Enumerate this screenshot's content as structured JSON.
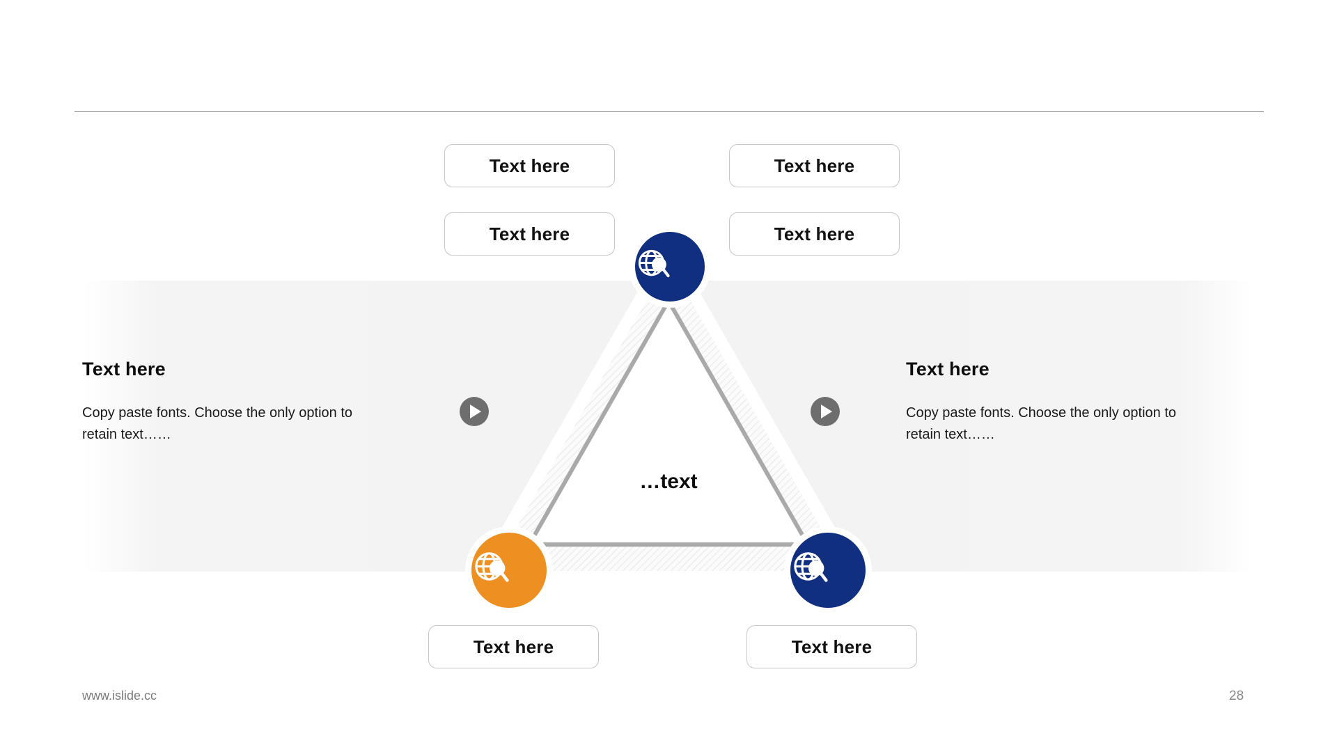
{
  "slide": {
    "page_number": "28",
    "footer_url": "www.islide.cc",
    "center_caption": "…text"
  },
  "colors": {
    "brand_blue": "#102F80",
    "brand_orange": "#EE9021",
    "rule_grey": "#8D8D8D",
    "chip_border": "#C6C6C6",
    "play_grey": "#6E6E6E",
    "band_grey": "#F3F3F3"
  },
  "chips": [
    {
      "id": "top-left-upper",
      "label": "Text here"
    },
    {
      "id": "top-left-lower",
      "label": "Text here"
    },
    {
      "id": "top-right-upper",
      "label": "Text here"
    },
    {
      "id": "top-right-lower",
      "label": "Text here"
    },
    {
      "id": "bottom-left",
      "label": "Text here"
    },
    {
      "id": "bottom-right",
      "label": "Text here"
    }
  ],
  "side_blocks": [
    {
      "id": "left",
      "title": "Text here",
      "body": "Copy paste fonts. Choose the only option to retain text……"
    },
    {
      "id": "right",
      "title": "Text here",
      "body": "Copy paste fonts. Choose the only option to retain text……"
    }
  ],
  "nodes": [
    {
      "id": "top",
      "icon": "globe-search-icon",
      "color": "#102F80"
    },
    {
      "id": "bottom-left",
      "icon": "globe-search-icon",
      "color": "#EE9021"
    },
    {
      "id": "bottom-right",
      "icon": "globe-search-icon",
      "color": "#102F80"
    }
  ],
  "play_buttons": [
    {
      "id": "left",
      "icon": "play-icon"
    },
    {
      "id": "right",
      "icon": "play-icon"
    }
  ]
}
